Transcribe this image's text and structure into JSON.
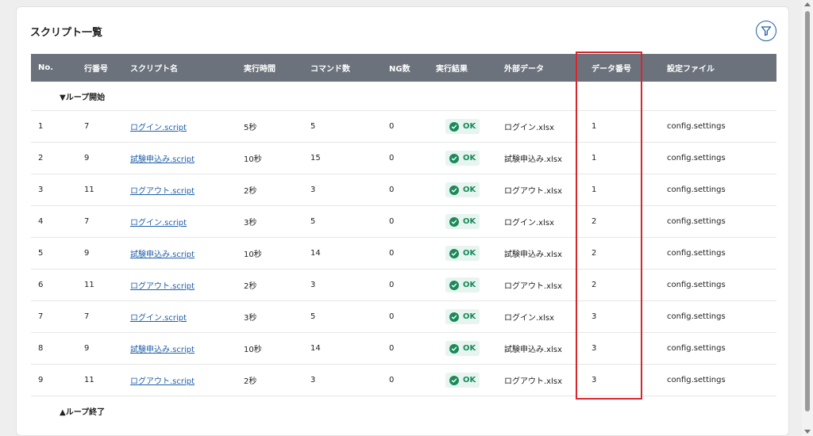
{
  "page": {
    "title": "スクリプト一覧"
  },
  "table": {
    "headers": {
      "no": "No.",
      "line": "行番号",
      "name": "スクリプト名",
      "time": "実行時間",
      "cmd": "コマンド数",
      "ng": "NG数",
      "result": "実行結果",
      "ext": "外部データ",
      "dnum": "データ番号",
      "conf": "設定ファイル"
    },
    "loop_start": "▼ループ開始",
    "loop_end": "▲ループ終了",
    "rows": [
      {
        "no": "1",
        "line": "7",
        "name": "ログイン.script",
        "time": "5秒",
        "cmd": "5",
        "ng": "0",
        "result": "OK",
        "ext": "ログイン.xlsx",
        "dnum": "1",
        "conf": "config.settings"
      },
      {
        "no": "2",
        "line": "9",
        "name": "試験申込み.script",
        "time": "10秒",
        "cmd": "15",
        "ng": "0",
        "result": "OK",
        "ext": "試験申込み.xlsx",
        "dnum": "1",
        "conf": "config.settings"
      },
      {
        "no": "3",
        "line": "11",
        "name": "ログアウト.script",
        "time": "2秒",
        "cmd": "3",
        "ng": "0",
        "result": "OK",
        "ext": "ログアウト.xlsx",
        "dnum": "1",
        "conf": "config.settings"
      },
      {
        "no": "4",
        "line": "7",
        "name": "ログイン.script",
        "time": "3秒",
        "cmd": "5",
        "ng": "0",
        "result": "OK",
        "ext": "ログイン.xlsx",
        "dnum": "2",
        "conf": "config.settings"
      },
      {
        "no": "5",
        "line": "9",
        "name": "試験申込み.script",
        "time": "10秒",
        "cmd": "14",
        "ng": "0",
        "result": "OK",
        "ext": "試験申込み.xlsx",
        "dnum": "2",
        "conf": "config.settings"
      },
      {
        "no": "6",
        "line": "11",
        "name": "ログアウト.script",
        "time": "2秒",
        "cmd": "3",
        "ng": "0",
        "result": "OK",
        "ext": "ログアウト.xlsx",
        "dnum": "2",
        "conf": "config.settings"
      },
      {
        "no": "7",
        "line": "7",
        "name": "ログイン.script",
        "time": "3秒",
        "cmd": "5",
        "ng": "0",
        "result": "OK",
        "ext": "ログイン.xlsx",
        "dnum": "3",
        "conf": "config.settings"
      },
      {
        "no": "8",
        "line": "9",
        "name": "試験申込み.script",
        "time": "10秒",
        "cmd": "14",
        "ng": "0",
        "result": "OK",
        "ext": "試験申込み.xlsx",
        "dnum": "3",
        "conf": "config.settings"
      },
      {
        "no": "9",
        "line": "11",
        "name": "ログアウト.script",
        "time": "2秒",
        "cmd": "3",
        "ng": "0",
        "result": "OK",
        "ext": "ログアウト.xlsx",
        "dnum": "3",
        "conf": "config.settings"
      }
    ]
  },
  "colors": {
    "header_bg": "#6c727c",
    "link": "#1f5fa8",
    "ok": "#1a8a5a",
    "ok_bg": "#e7f4ef",
    "highlight": "#d9262c"
  },
  "icons": {
    "filter": "filter-icon",
    "ok": "check-circle-icon"
  }
}
